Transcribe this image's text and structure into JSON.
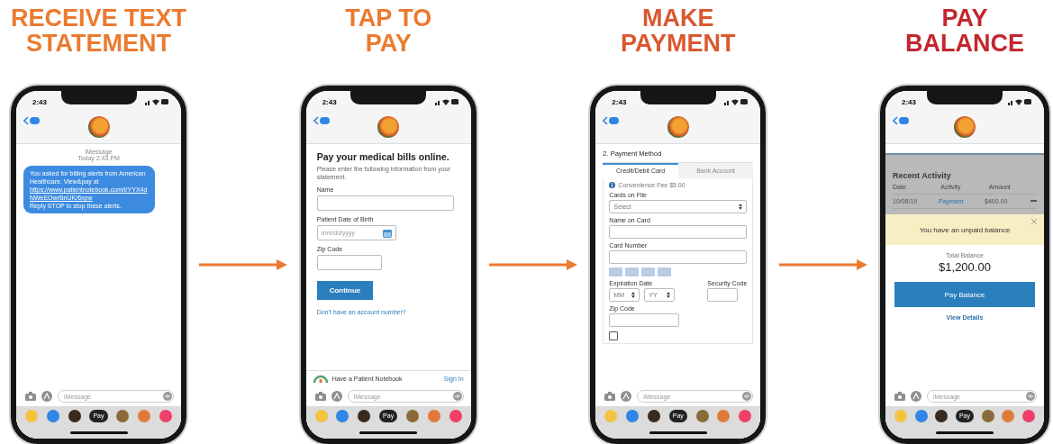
{
  "steps": [
    {
      "kind": "messages",
      "title_lines": [
        "RECEIVE TEXT",
        "STATEMENT"
      ],
      "color": "#ec7a2f",
      "time": "2:43",
      "meta_label": "iMessage",
      "meta_time": "Today 2:43 PM",
      "message_before": "You asked for billing alerts from American Healthcare. View&pay at",
      "message_link": "https://www.patientnotebook.com/t/YYX4dNWeEOwrBnUK/6xpw",
      "message_after": "Reply STOP to stop these alerts.",
      "compose_placeholder": "iMessage",
      "pay_label": "Pay"
    },
    {
      "kind": "form",
      "title_lines": [
        "TAP TO",
        "PAY"
      ],
      "color": "#ec7a2f",
      "time": "2:43",
      "heading": "Pay your medical bills online.",
      "intro": "Please enter the following information from your statement.",
      "fields": [
        {
          "kind": "text",
          "label": "Name"
        },
        {
          "kind": "date",
          "label": "Patient Date of Birth",
          "placeholder": "mm/dd/yyyy"
        },
        {
          "kind": "text",
          "label": "Zip Code"
        }
      ],
      "button": "Continue",
      "link": "Don't have an account number?",
      "promo": "Have a Patient Notebook",
      "promo_link": "Sign In",
      "compose_placeholder": "iMessage",
      "pay_label": "Pay"
    },
    {
      "kind": "payment",
      "title_lines": [
        "MAKE",
        "PAYMENT"
      ],
      "color": "#d9582f",
      "time": "2:43",
      "section": "2. Payment Method",
      "tabs": [
        {
          "label": "Credit/Debit Card",
          "selected": true
        },
        {
          "label": "Bank Account",
          "selected": false
        }
      ],
      "fee": "Convenience Fee $5.00",
      "cards_label": "Cards on File",
      "cards_value": "Select",
      "name_label": "Name on Card",
      "number_label": "Card Number",
      "expiry_label": "Expiration Date",
      "month": "MM",
      "year": "YY",
      "cvc_label": "Security Code",
      "zip_label": "Zip Code",
      "save_checked": false,
      "compose_placeholder": "iMessage",
      "pay_label": "Pay"
    },
    {
      "kind": "balance",
      "title_lines": [
        "PAY",
        "BALANCE"
      ],
      "color": "#c3272f",
      "time": "2:43",
      "heading": "Recent Activity",
      "columns": [
        "Date",
        "Activity",
        "Amount"
      ],
      "rows": [
        {
          "date": "10/08/19",
          "activity": "Payment",
          "amount": "$400.00"
        }
      ],
      "banner": "You have an unpaid balance",
      "total_label": "Total Balance",
      "total": "$1,200.00",
      "button": "Pay Balance",
      "link": "View Details",
      "compose_placeholder": "iMessage",
      "pay_label": "Pay"
    }
  ]
}
